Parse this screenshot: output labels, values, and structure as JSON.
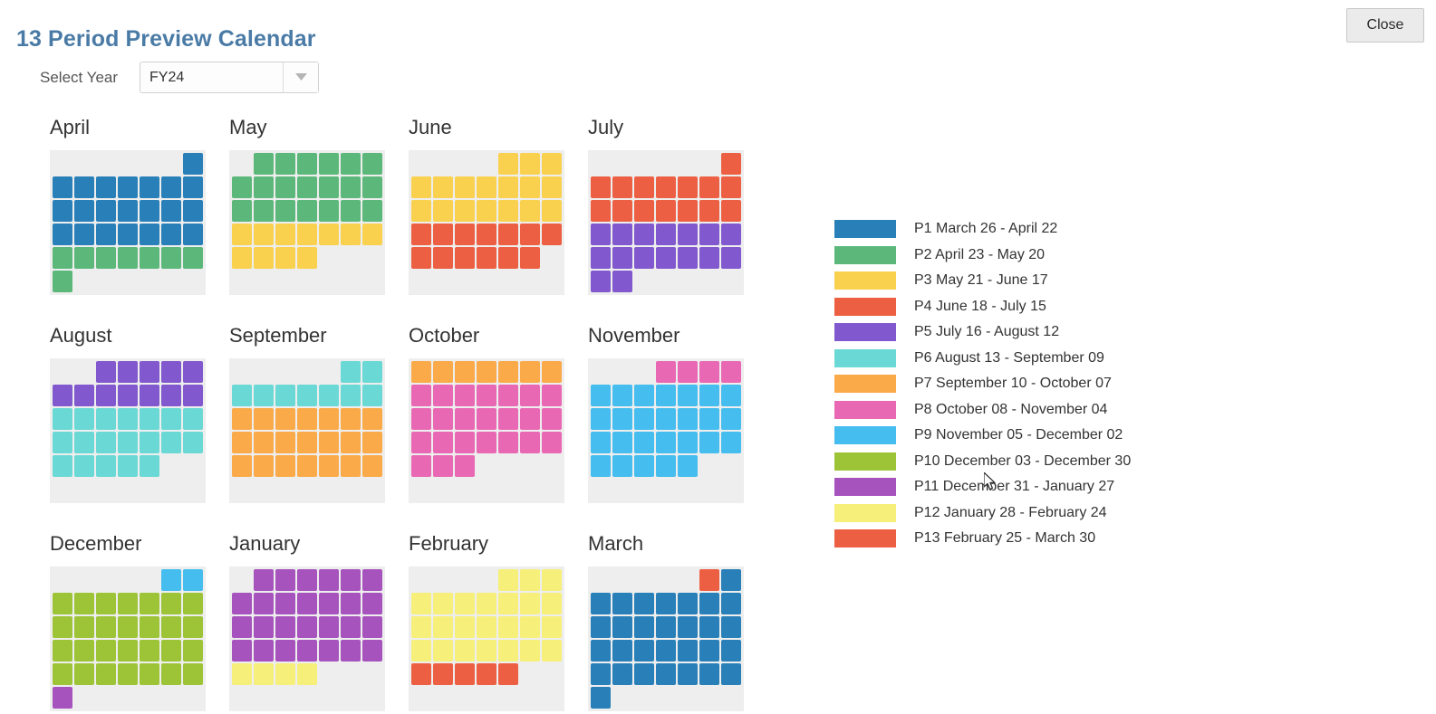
{
  "header": {
    "title": "13 Period Preview Calendar",
    "close_label": "Close"
  },
  "year_selector": {
    "label": "Select Year",
    "value": "FY24",
    "placeholder": "FY24",
    "arrow_icon": "chevron-down-icon"
  },
  "colors": {
    "p1": "#2980b9",
    "p2": "#5cb87a",
    "p3": "#f9d14f",
    "p4": "#ed5f43",
    "p5": "#8158cd",
    "p6": "#6ad9d5",
    "p7": "#faaa48",
    "p8": "#e968b4",
    "p9": "#45bdee",
    "p10": "#9dc437",
    "p11": "#a653bd",
    "p12": "#f6ef79",
    "p13": "#ed5f43",
    "title": "#4a7ba6",
    "calendar_background": "#eeeeee"
  },
  "legend": {
    "items": [
      {
        "period": "P1",
        "label": "P1 March 26 - April 22",
        "color": "#2980b9"
      },
      {
        "period": "P2",
        "label": "P2 April 23 - May 20",
        "color": "#5cb87a"
      },
      {
        "period": "P3",
        "label": "P3 May 21 - June 17",
        "color": "#f9d14f"
      },
      {
        "period": "P4",
        "label": "P4 June 18 - July 15",
        "color": "#ed5f43"
      },
      {
        "period": "P5",
        "label": "P5 July 16 - August 12",
        "color": "#8158cd"
      },
      {
        "period": "P6",
        "label": "P6 August 13 - September 09",
        "color": "#6ad9d5"
      },
      {
        "period": "P7",
        "label": "P7 September 10 - October 07",
        "color": "#faaa48"
      },
      {
        "period": "P8",
        "label": "P8 October 08 - November 04",
        "color": "#e968b4"
      },
      {
        "period": "P9",
        "label": "P9 November 05 - December 02",
        "color": "#45bdee"
      },
      {
        "period": "P10",
        "label": "P10 December 03 - December 30",
        "color": "#9dc437"
      },
      {
        "period": "P11",
        "label": "P11 December 31 - January 27",
        "color": "#a653bd"
      },
      {
        "period": "P12",
        "label": "P12 January 28 - February 24",
        "color": "#f6ef79"
      },
      {
        "period": "P13",
        "label": "P13 February 25 - March 30",
        "color": "#ed5f43"
      }
    ]
  },
  "calendar": {
    "months": [
      {
        "name": "April",
        "lead_blank": 6,
        "days": 30,
        "day_colors": [
          "#2980b9",
          "#2980b9",
          "#2980b9",
          "#2980b9",
          "#2980b9",
          "#2980b9",
          "#2980b9",
          "#2980b9",
          "#2980b9",
          "#2980b9",
          "#2980b9",
          "#2980b9",
          "#2980b9",
          "#2980b9",
          "#2980b9",
          "#2980b9",
          "#2980b9",
          "#2980b9",
          "#2980b9",
          "#2980b9",
          "#2980b9",
          "#2980b9",
          "#5cb87a",
          "#5cb87a",
          "#5cb87a",
          "#5cb87a",
          "#5cb87a",
          "#5cb87a",
          "#5cb87a",
          "#5cb87a"
        ]
      },
      {
        "name": "May",
        "lead_blank": 1,
        "days": 31,
        "day_colors": [
          "#5cb87a",
          "#5cb87a",
          "#5cb87a",
          "#5cb87a",
          "#5cb87a",
          "#5cb87a",
          "#5cb87a",
          "#5cb87a",
          "#5cb87a",
          "#5cb87a",
          "#5cb87a",
          "#5cb87a",
          "#5cb87a",
          "#5cb87a",
          "#5cb87a",
          "#5cb87a",
          "#5cb87a",
          "#5cb87a",
          "#5cb87a",
          "#5cb87a",
          "#f9d14f",
          "#f9d14f",
          "#f9d14f",
          "#f9d14f",
          "#f9d14f",
          "#f9d14f",
          "#f9d14f",
          "#f9d14f",
          "#f9d14f",
          "#f9d14f",
          "#f9d14f"
        ]
      },
      {
        "name": "June",
        "lead_blank": 4,
        "days": 30,
        "day_colors": [
          "#f9d14f",
          "#f9d14f",
          "#f9d14f",
          "#f9d14f",
          "#f9d14f",
          "#f9d14f",
          "#f9d14f",
          "#f9d14f",
          "#f9d14f",
          "#f9d14f",
          "#f9d14f",
          "#f9d14f",
          "#f9d14f",
          "#f9d14f",
          "#f9d14f",
          "#f9d14f",
          "#f9d14f",
          "#ed5f43",
          "#ed5f43",
          "#ed5f43",
          "#ed5f43",
          "#ed5f43",
          "#ed5f43",
          "#ed5f43",
          "#ed5f43",
          "#ed5f43",
          "#ed5f43",
          "#ed5f43",
          "#ed5f43",
          "#ed5f43"
        ]
      },
      {
        "name": "July",
        "lead_blank": 6,
        "days": 31,
        "day_colors": [
          "#ed5f43",
          "#ed5f43",
          "#ed5f43",
          "#ed5f43",
          "#ed5f43",
          "#ed5f43",
          "#ed5f43",
          "#ed5f43",
          "#ed5f43",
          "#ed5f43",
          "#ed5f43",
          "#ed5f43",
          "#ed5f43",
          "#ed5f43",
          "#ed5f43",
          "#8158cd",
          "#8158cd",
          "#8158cd",
          "#8158cd",
          "#8158cd",
          "#8158cd",
          "#8158cd",
          "#8158cd",
          "#8158cd",
          "#8158cd",
          "#8158cd",
          "#8158cd",
          "#8158cd",
          "#8158cd",
          "#8158cd",
          "#8158cd"
        ]
      },
      {
        "name": "August",
        "lead_blank": 2,
        "days": 31,
        "day_colors": [
          "#8158cd",
          "#8158cd",
          "#8158cd",
          "#8158cd",
          "#8158cd",
          "#8158cd",
          "#8158cd",
          "#8158cd",
          "#8158cd",
          "#8158cd",
          "#8158cd",
          "#8158cd",
          "#6ad9d5",
          "#6ad9d5",
          "#6ad9d5",
          "#6ad9d5",
          "#6ad9d5",
          "#6ad9d5",
          "#6ad9d5",
          "#6ad9d5",
          "#6ad9d5",
          "#6ad9d5",
          "#6ad9d5",
          "#6ad9d5",
          "#6ad9d5",
          "#6ad9d5",
          "#6ad9d5",
          "#6ad9d5",
          "#6ad9d5",
          "#6ad9d5",
          "#6ad9d5"
        ]
      },
      {
        "name": "September",
        "lead_blank": 5,
        "days": 30,
        "day_colors": [
          "#6ad9d5",
          "#6ad9d5",
          "#6ad9d5",
          "#6ad9d5",
          "#6ad9d5",
          "#6ad9d5",
          "#6ad9d5",
          "#6ad9d5",
          "#6ad9d5",
          "#faaa48",
          "#faaa48",
          "#faaa48",
          "#faaa48",
          "#faaa48",
          "#faaa48",
          "#faaa48",
          "#faaa48",
          "#faaa48",
          "#faaa48",
          "#faaa48",
          "#faaa48",
          "#faaa48",
          "#faaa48",
          "#faaa48",
          "#faaa48",
          "#faaa48",
          "#faaa48",
          "#faaa48",
          "#faaa48",
          "#faaa48"
        ]
      },
      {
        "name": "October",
        "lead_blank": 0,
        "days": 31,
        "day_colors": [
          "#faaa48",
          "#faaa48",
          "#faaa48",
          "#faaa48",
          "#faaa48",
          "#faaa48",
          "#faaa48",
          "#e968b4",
          "#e968b4",
          "#e968b4",
          "#e968b4",
          "#e968b4",
          "#e968b4",
          "#e968b4",
          "#e968b4",
          "#e968b4",
          "#e968b4",
          "#e968b4",
          "#e968b4",
          "#e968b4",
          "#e968b4",
          "#e968b4",
          "#e968b4",
          "#e968b4",
          "#e968b4",
          "#e968b4",
          "#e968b4",
          "#e968b4",
          "#e968b4",
          "#e968b4",
          "#e968b4"
        ]
      },
      {
        "name": "November",
        "lead_blank": 3,
        "days": 30,
        "day_colors": [
          "#e968b4",
          "#e968b4",
          "#e968b4",
          "#e968b4",
          "#45bdee",
          "#45bdee",
          "#45bdee",
          "#45bdee",
          "#45bdee",
          "#45bdee",
          "#45bdee",
          "#45bdee",
          "#45bdee",
          "#45bdee",
          "#45bdee",
          "#45bdee",
          "#45bdee",
          "#45bdee",
          "#45bdee",
          "#45bdee",
          "#45bdee",
          "#45bdee",
          "#45bdee",
          "#45bdee",
          "#45bdee",
          "#45bdee",
          "#45bdee",
          "#45bdee",
          "#45bdee",
          "#45bdee"
        ]
      },
      {
        "name": "December",
        "lead_blank": 5,
        "days": 31,
        "day_colors": [
          "#45bdee",
          "#45bdee",
          "#9dc437",
          "#9dc437",
          "#9dc437",
          "#9dc437",
          "#9dc437",
          "#9dc437",
          "#9dc437",
          "#9dc437",
          "#9dc437",
          "#9dc437",
          "#9dc437",
          "#9dc437",
          "#9dc437",
          "#9dc437",
          "#9dc437",
          "#9dc437",
          "#9dc437",
          "#9dc437",
          "#9dc437",
          "#9dc437",
          "#9dc437",
          "#9dc437",
          "#9dc437",
          "#9dc437",
          "#9dc437",
          "#9dc437",
          "#9dc437",
          "#9dc437",
          "#a653bd"
        ]
      },
      {
        "name": "January",
        "lead_blank": 1,
        "days": 31,
        "day_colors": [
          "#a653bd",
          "#a653bd",
          "#a653bd",
          "#a653bd",
          "#a653bd",
          "#a653bd",
          "#a653bd",
          "#a653bd",
          "#a653bd",
          "#a653bd",
          "#a653bd",
          "#a653bd",
          "#a653bd",
          "#a653bd",
          "#a653bd",
          "#a653bd",
          "#a653bd",
          "#a653bd",
          "#a653bd",
          "#a653bd",
          "#a653bd",
          "#a653bd",
          "#a653bd",
          "#a653bd",
          "#a653bd",
          "#a653bd",
          "#a653bd",
          "#f6ef79",
          "#f6ef79",
          "#f6ef79",
          "#f6ef79"
        ]
      },
      {
        "name": "February",
        "lead_blank": 4,
        "days": 29,
        "day_colors": [
          "#f6ef79",
          "#f6ef79",
          "#f6ef79",
          "#f6ef79",
          "#f6ef79",
          "#f6ef79",
          "#f6ef79",
          "#f6ef79",
          "#f6ef79",
          "#f6ef79",
          "#f6ef79",
          "#f6ef79",
          "#f6ef79",
          "#f6ef79",
          "#f6ef79",
          "#f6ef79",
          "#f6ef79",
          "#f6ef79",
          "#f6ef79",
          "#f6ef79",
          "#f6ef79",
          "#f6ef79",
          "#f6ef79",
          "#f6ef79",
          "#ed5f43",
          "#ed5f43",
          "#ed5f43",
          "#ed5f43",
          "#ed5f43"
        ]
      },
      {
        "name": "March",
        "lead_blank": 5,
        "days": 31,
        "day_colors": [
          "#ed5f43",
          "#2980b9",
          "#2980b9",
          "#2980b9",
          "#2980b9",
          "#2980b9",
          "#2980b9",
          "#2980b9",
          "#2980b9",
          "#2980b9",
          "#2980b9",
          "#2980b9",
          "#2980b9",
          "#2980b9",
          "#2980b9",
          "#2980b9",
          "#2980b9",
          "#2980b9",
          "#2980b9",
          "#2980b9",
          "#2980b9",
          "#2980b9",
          "#2980b9",
          "#2980b9",
          "#2980b9",
          "#2980b9",
          "#2980b9",
          "#2980b9",
          "#2980b9",
          "#2980b9",
          "#2980b9"
        ]
      }
    ]
  }
}
